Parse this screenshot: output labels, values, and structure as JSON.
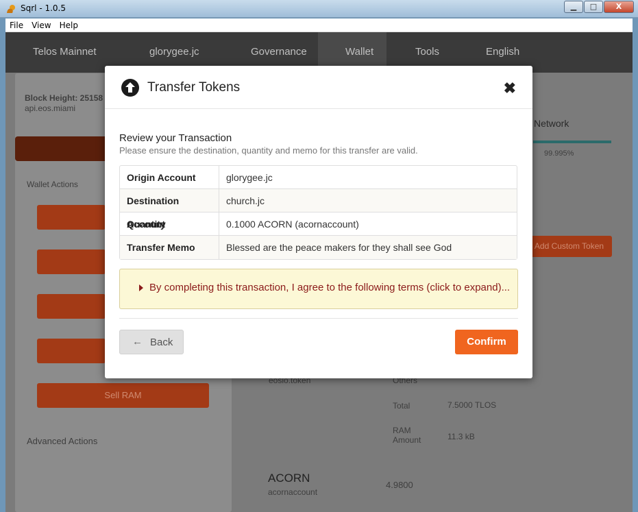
{
  "window": {
    "title": "Sqrl - 1.0.5",
    "min": "▁",
    "max": "□",
    "close": "X"
  },
  "menu": [
    "File",
    "View",
    "Help"
  ],
  "nav": {
    "network": "Telos Mainnet",
    "account": "glorygee.jc",
    "governance": "Governance",
    "wallet": "Wallet",
    "tools": "Tools",
    "language": "English"
  },
  "background": {
    "block_height": "Block Height: 25158",
    "api": "api.eos.miami",
    "network_label": "Network",
    "network_pct": "99.995%",
    "wallet_actions": "Wallet Actions",
    "sell_ram": "Sell RAM",
    "advanced_actions": "Advanced Actions",
    "add_custom_token": "Add Custom Token",
    "eosio_token": "eosio.token",
    "others": "Others",
    "total_label": "Total",
    "total_value": "7.5000 TLOS",
    "ram_label": "RAM Amount",
    "ram_value": "11.3 kB",
    "acorn": "ACORN",
    "acorn_account": "acornaccount",
    "acorn_value": "4.9800"
  },
  "modal": {
    "title": "Transfer Tokens",
    "close": "✖",
    "review_title": "Review your Transaction",
    "review_sub": "Please ensure the destination, quantity and memo for this transfer are valid.",
    "rows": [
      {
        "label": "Origin Account",
        "value": "glorygee.jc"
      },
      {
        "label": "Destination Account",
        "value": "church.jc"
      },
      {
        "label": "Quantity",
        "value": "0.1000 ACORN (acornaccount)"
      },
      {
        "label": "Transfer Memo",
        "value": "Blessed are the peace makers for they shall see God"
      }
    ],
    "terms": "By completing this transaction, I agree to the following terms (click to expand)...",
    "back": "Back",
    "confirm": "Confirm"
  },
  "colors": {
    "accent": "#f0651f",
    "terms_bg": "#fcf8d6",
    "terms_text": "#8b1a1a"
  }
}
